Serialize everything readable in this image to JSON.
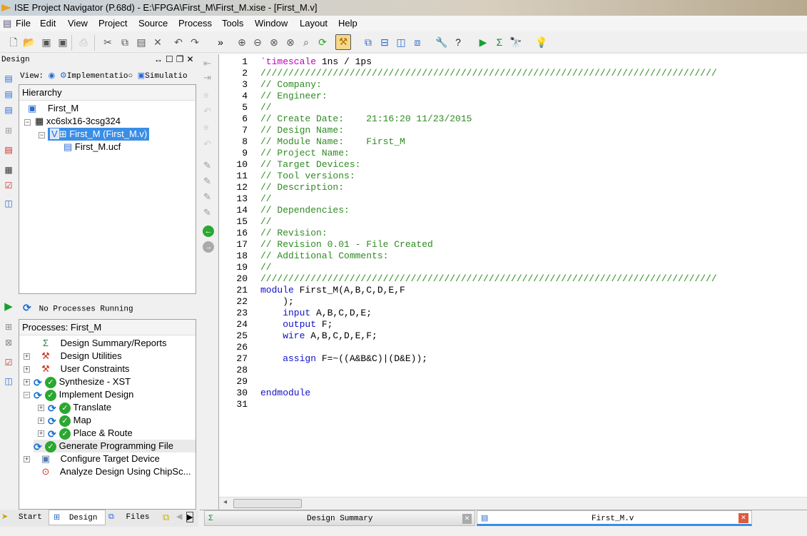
{
  "window": {
    "title": "ISE Project Navigator (P.68d) - E:\\FPGA\\First_M\\First_M.xise - [First_M.v]"
  },
  "menu": [
    "File",
    "Edit",
    "View",
    "Project",
    "Source",
    "Process",
    "Tools",
    "Window",
    "Layout",
    "Help"
  ],
  "design_panel": {
    "title": "Design",
    "view_label": "View:",
    "view_options": [
      "Implementatio",
      "Simulatio"
    ],
    "selected_view": "Implementation",
    "hierarchy_title": "Hierarchy",
    "hierarchy": [
      "First_M",
      "xc6slx16-3csg324",
      "First_M (First_M.v)",
      "First_M.ucf"
    ]
  },
  "process_status": "No Processes Running",
  "processes": {
    "title": "Processes: First_M",
    "items": [
      {
        "label": "Design Summary/Reports",
        "icon": "sigma-icon",
        "status": ""
      },
      {
        "label": "Design Utilities",
        "icon": "tools-icon",
        "status": ""
      },
      {
        "label": "User Constraints",
        "icon": "tools-icon",
        "status": ""
      },
      {
        "label": "Synthesize - XST",
        "icon": "refresh-icon",
        "status": "done"
      },
      {
        "label": "Implement Design",
        "icon": "refresh-icon",
        "status": "done"
      },
      {
        "label": "Translate",
        "icon": "refresh-icon",
        "status": "done"
      },
      {
        "label": "Map",
        "icon": "refresh-icon",
        "status": "done"
      },
      {
        "label": "Place & Route",
        "icon": "refresh-icon",
        "status": "done"
      },
      {
        "label": "Generate Programming File",
        "icon": "refresh-icon",
        "status": "done"
      },
      {
        "label": "Configure Target Device",
        "icon": "device-icon",
        "status": ""
      },
      {
        "label": "Analyze Design Using ChipSc...",
        "icon": "chipscope-icon",
        "status": ""
      }
    ]
  },
  "left_tabs": [
    "Start",
    "Design",
    "Files"
  ],
  "editor_tabs": [
    {
      "label": "Design Summary",
      "active": false
    },
    {
      "label": "First_M.v",
      "active": true
    }
  ],
  "code": [
    [
      [
        "dir",
        "`timescale"
      ],
      [
        "plain",
        " 1ns / 1ps"
      ]
    ],
    [
      [
        "comment",
        "//////////////////////////////////////////////////////////////////////////////////"
      ]
    ],
    [
      [
        "comment",
        "// Company: "
      ]
    ],
    [
      [
        "comment",
        "// Engineer: "
      ]
    ],
    [
      [
        "comment",
        "// "
      ]
    ],
    [
      [
        "comment",
        "// Create Date:    21:16:20 11/23/2015 "
      ]
    ],
    [
      [
        "comment",
        "// Design Name: "
      ]
    ],
    [
      [
        "comment",
        "// Module Name:    First_M "
      ]
    ],
    [
      [
        "comment",
        "// Project Name: "
      ]
    ],
    [
      [
        "comment",
        "// Target Devices: "
      ]
    ],
    [
      [
        "comment",
        "// Tool versions: "
      ]
    ],
    [
      [
        "comment",
        "// Description: "
      ]
    ],
    [
      [
        "comment",
        "//"
      ]
    ],
    [
      [
        "comment",
        "// Dependencies: "
      ]
    ],
    [
      [
        "comment",
        "//"
      ]
    ],
    [
      [
        "comment",
        "// Revision: "
      ]
    ],
    [
      [
        "comment",
        "// Revision 0.01 - File Created"
      ]
    ],
    [
      [
        "comment",
        "// Additional Comments: "
      ]
    ],
    [
      [
        "comment",
        "//"
      ]
    ],
    [
      [
        "comment",
        "//////////////////////////////////////////////////////////////////////////////////"
      ]
    ],
    [
      [
        "kw",
        "module"
      ],
      [
        "plain",
        " First_M(A,B,C,D,E,F"
      ]
    ],
    [
      [
        "plain",
        "    );"
      ]
    ],
    [
      [
        "kw",
        "    input"
      ],
      [
        "plain",
        " A,B,C,D,E;"
      ]
    ],
    [
      [
        "kw",
        "    output"
      ],
      [
        "plain",
        " F;"
      ]
    ],
    [
      [
        "kw",
        "    wire"
      ],
      [
        "plain",
        " A,B,C,D,E,F;"
      ]
    ],
    [
      [
        "plain",
        ""
      ]
    ],
    [
      [
        "kw",
        "    assign"
      ],
      [
        "plain",
        " F=~((A&B&C)|(D&E));"
      ]
    ],
    [
      [
        "plain",
        ""
      ]
    ],
    [
      [
        "plain",
        ""
      ]
    ],
    [
      [
        "kw",
        "endmodule"
      ]
    ],
    [
      [
        "plain",
        ""
      ]
    ]
  ]
}
